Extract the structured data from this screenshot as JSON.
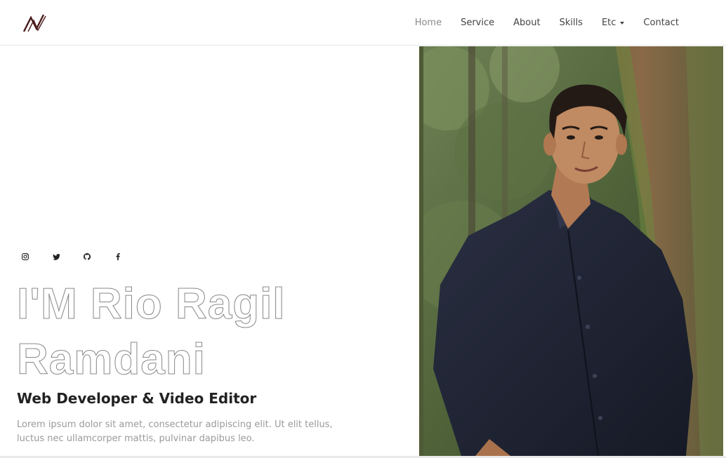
{
  "brand": {
    "logo_icon": "nv-monogram-logo",
    "logo_color": "#4a1a1a"
  },
  "nav": {
    "items": [
      {
        "label": "Home",
        "active": true
      },
      {
        "label": "Service"
      },
      {
        "label": "About"
      },
      {
        "label": "Skills"
      },
      {
        "label": "Etc",
        "dropdown": true
      },
      {
        "label": "Contact"
      }
    ]
  },
  "hero": {
    "socials": [
      {
        "icon": "instagram-icon"
      },
      {
        "icon": "twitter-icon"
      },
      {
        "icon": "github-icon"
      },
      {
        "icon": "facebook-icon"
      }
    ],
    "name": "I'M Rio Ragil Ramdani",
    "subtitle": "Web Developer & Video Editor",
    "description": "Lorem ipsum dolor sit amet, consectetur adipiscing elit. Ut elit tellus, luctus nec ullamcorper mattis, pulvinar dapibus leo.",
    "photo": "portrait-photo"
  },
  "colors": {
    "text_dark": "#222222",
    "text_muted": "#9a9a9a",
    "nav_active": "#8a8a8a",
    "shirt": "#1f2333",
    "foliage": "#5a6b45"
  }
}
